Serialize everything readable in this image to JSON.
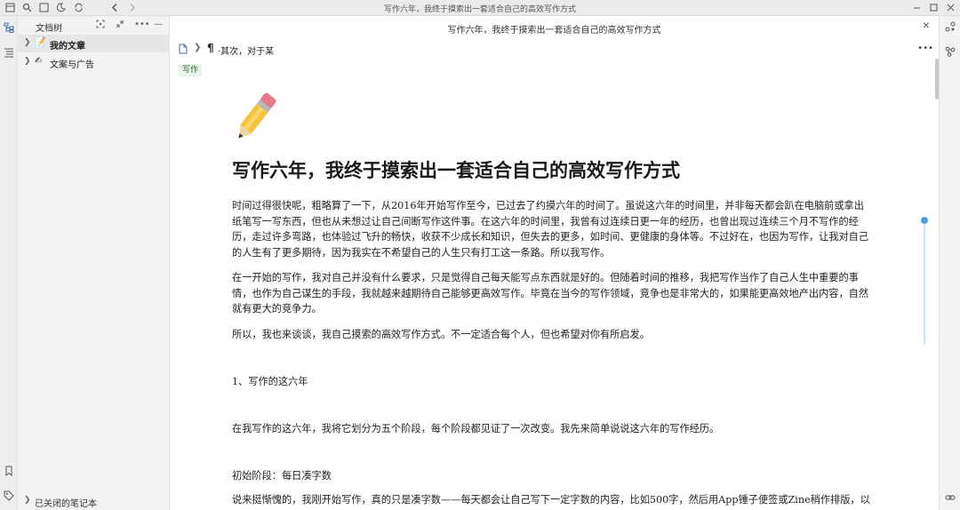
{
  "window": {
    "title": "写作六年，我终于摸索出一套适合自己的高效写作方式"
  },
  "sidebar": {
    "header": "文档树",
    "items": [
      {
        "emoji": "📝",
        "label": "我的文章",
        "selected": true
      },
      {
        "emoji": "✍",
        "label": "文案与广告",
        "selected": false
      }
    ],
    "closed_notebooks": "已关闭的笔记本"
  },
  "tab": {
    "title": "写作六年，我终于摸索出一套适合自己的高效写作方式"
  },
  "breadcrumb": {
    "para_label": "¶",
    "text": "·其次，对于某"
  },
  "tag": "写作",
  "document": {
    "title": "写作六年，我终于摸索出一套适合自己的高效写作方式",
    "paragraphs": [
      [
        "时间过得很快呢，粗略算了一下，从2016年开始写作至今，已过去了约摸六年的时间了。虽说这六年的时间里，并非每天都会趴在电脑前或拿出",
        "纸笔写一写东西，但也从未想过让自己间断写作这件事。在这六年的时间里，我曾有过连续日更一年的经历，也曾出现过连续三个月不写作的经",
        "历，走过许多弯路，也体验过飞升的畅快，收获不少成长和知识，但失去的更多，如时间、更健康的身体等。不过好在，也因为写作，让我对自己",
        "的人生有了更多期待，因为我实在不希望自己的人生只有打工这一条路。所以我写作。"
      ],
      [
        "在一开始的写作，我对自己并没有什么要求，只是觉得自己每天能写点东西就是好的。但随着时间的推移，我把写作当作了自己人生中重要的事",
        "情，也作为自己谋生的手段，我就越来越期待自己能够更高效写作。毕竟在当今的写作领域，竞争也是非常大的，如果能更高效地产出内容，自然",
        "就有更大的竞争力。"
      ],
      [
        "所以，我也来谈谈，我自己摸索的高效写作方式。不一定适合每个人，但也希望对你有所启发。"
      ],
      [
        "1、写作的这六年"
      ],
      [
        "在我写作的这六年，我将它划分为五个阶段，每个阶段都见证了一次改变。我先来简单说说这六年的写作经历。"
      ],
      [
        "初始阶段：每日凑字数"
      ],
      [
        "说来挺惭愧的，我刚开始写作，真的只是凑字数——每天都会让自己写下一定字数的内容，比如500字，然后用App锤子便签或Zine稍作排版，以"
      ]
    ]
  },
  "icons": {
    "topbar": [
      "sidebar-toggle-icon",
      "search-icon",
      "window-icon",
      "moon-icon",
      "sync-icon",
      "back-icon",
      "forward-icon",
      "minimize-icon",
      "restore-icon",
      "close-icon"
    ],
    "colors": {
      "accent": "#4b9fd9",
      "tag_bg": "#e8f3e8",
      "tag_fg": "#2d6f3a"
    }
  }
}
